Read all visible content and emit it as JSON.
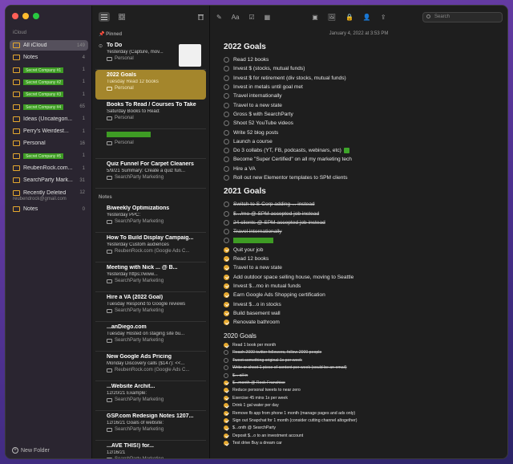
{
  "sidebar": {
    "icloud_label": "iCloud",
    "folders": [
      {
        "name": "All iCloud",
        "count": "149"
      },
      {
        "name": "Notes",
        "count": "4"
      },
      {
        "name": "Secret Company #1",
        "count": "1",
        "redacted": true
      },
      {
        "name": "Secret Company #2",
        "count": "1",
        "redacted": true
      },
      {
        "name": "Secret Company #3",
        "count": "1",
        "redacted": true
      },
      {
        "name": "Secret Company #4",
        "count": "65",
        "redacted": true
      },
      {
        "name": "Ideas (Uncategori...",
        "count": "1"
      },
      {
        "name": "Perry's Weirdest...",
        "count": "1"
      },
      {
        "name": "Personal",
        "count": "16"
      },
      {
        "name": "Secret Company #5",
        "count": "1",
        "redacted": true
      },
      {
        "name": "ReubenRock.com...",
        "count": "1"
      },
      {
        "name": "SearchParty Mark...",
        "count": "31"
      },
      {
        "name": "Recently Deleted",
        "count": "12"
      }
    ],
    "gmail_label": "reubendrock@gmail.com",
    "gmail_folders": [
      {
        "name": "Notes",
        "count": "0"
      }
    ],
    "new_folder": "New Folder"
  },
  "list": {
    "pinned_label": "Pinned",
    "notes_label": "Notes",
    "pinned": [
      {
        "title": "To Do",
        "meta": "Yesterday  (Capture, mov...",
        "folder": "Personal"
      },
      {
        "title": "2022 Goals",
        "meta": "Tuesday  Read 12 books",
        "folder": "Personal"
      },
      {
        "title": "Books To Read / Courses To Take",
        "meta": "Saturday  Books to Read:",
        "folder": "Personal"
      },
      {
        "title": "",
        "meta": "",
        "folder": "Personal"
      },
      {
        "title": "Quiz Funnel For Carpet Cleaners",
        "meta": "5/9/21  Summary: Create a quiz fun...",
        "folder": "SearchParty Marketing"
      }
    ],
    "notes": [
      {
        "title": "Biweekly Optimizations",
        "meta": "Yesterday  PPC:",
        "folder": "SearchParty Marketing"
      },
      {
        "title": "How To Build Display Campaig...",
        "meta": "Yesterday  Custom audiences",
        "folder": "ReubenRock.com (Google Ads C..."
      },
      {
        "title": "Meeting with Nick ... @ B...",
        "meta": "Yesterday  https://www...",
        "folder": "SearchParty Marketing"
      },
      {
        "title": "Hire a VA (2022 Goal)",
        "meta": "Tuesday  Respond to Google reviews",
        "folder": "SearchParty Marketing"
      },
      {
        "title": "...anDiego.com",
        "meta": "Tuesday  Hosted on staging site bu...",
        "folder": "SearchParty Marketing"
      },
      {
        "title": "New Google Ads Pricing",
        "meta": "Monday  Discovery calls ($147): <<...",
        "folder": "ReubenRock.com (Google Ads C..."
      },
      {
        "title": "...Website Archit...",
        "meta": "12/20/21  Example:",
        "folder": "SearchParty Marketing"
      },
      {
        "title": "GSP.com Redesign Notes 1207...",
        "meta": "12/16/21  Goals of website:",
        "folder": "SearchParty Marketing"
      },
      {
        "title": "...AVE THIS!) for...",
        "meta": "12/16/21",
        "folder": "SearchParty Marketing"
      }
    ]
  },
  "editor": {
    "search_placeholder": "Search",
    "date": "January 4, 2022 at 3:53 PM",
    "sections": [
      {
        "heading": "2022 Goals",
        "style": "h2",
        "items": [
          {
            "text": "Read 12 books"
          },
          {
            "text": "Invest $ (stocks, mutual funds)"
          },
          {
            "text": "Invest $ for retirement (div stocks, mutual funds)"
          },
          {
            "text": "Invest in metals until goal met"
          },
          {
            "text": "Travel internationally"
          },
          {
            "text": "Travel to a new state"
          },
          {
            "text": "Gross $ with SearchParty"
          },
          {
            "text": "Shoot 52 YouTube videos"
          },
          {
            "text": "Write 52 blog posts"
          },
          {
            "text": "Launch a course"
          },
          {
            "text": "Do 3 collabs (YT, FB, podcasts, webinars, etc)"
          },
          {
            "text": "Become \"Super Certified\" on all my marketing tech"
          },
          {
            "text": "Hire a VA"
          },
          {
            "text": "Roll out new Elementor templates to SPM clients"
          }
        ]
      },
      {
        "heading": "2021 Goals",
        "style": "h2",
        "items": [
          {
            "text": "Switch to S-Corp adding ... instead",
            "done": false,
            "strike": true
          },
          {
            "text": "$.../mo @ SPM accepted job instead",
            "done": false,
            "strike": true
          },
          {
            "text": "24 clients @ SPM accepted job instead",
            "done": false,
            "strike": true
          },
          {
            "text": "Travel internationally",
            "done": false,
            "strike": true
          },
          {
            "text": "",
            "done": false
          },
          {
            "text": "Quit your job",
            "done": true
          },
          {
            "text": "Read 12 books",
            "done": true
          },
          {
            "text": "Travel to a new state",
            "done": true
          },
          {
            "text": "Add outdoor space selling house, moving to Seattle",
            "done": true
          },
          {
            "text": "Invest $...mo in mutual funds",
            "done": true
          },
          {
            "text": "Earn Google Ads Shopping certification",
            "done": true
          },
          {
            "text": "Invest $...o in stocks",
            "done": true
          },
          {
            "text": "Build basement wall",
            "done": true
          },
          {
            "text": "Renovate bathroom",
            "done": true
          }
        ]
      },
      {
        "heading": "2020 Goals",
        "style": "h3",
        "items": [
          {
            "text": "Read 1 book per month",
            "done": true
          },
          {
            "text": "Reach 2000 twitter followers, follow 2000 people",
            "done": false,
            "strike": true
          },
          {
            "text": "Tweet something original 1x per week",
            "done": false,
            "strike": true
          },
          {
            "text": "Write or shoot 1 piece of content per week (could be an email)",
            "done": false,
            "strike": true
          },
          {
            "text": "$... all in",
            "done": false,
            "strike": true
          },
          {
            "text": "$...month @ Rock Franchise",
            "done": true,
            "strike": true
          },
          {
            "text": "Reduce personal tweets to near zero",
            "done": true
          },
          {
            "text": "Exercise 45 mins 1x per week",
            "done": true
          },
          {
            "text": "Drink 1 gal water per day",
            "done": true
          },
          {
            "text": "Remove fb app from phone 1 month (manage pages and ads only)",
            "done": true
          },
          {
            "text": "Sign out Snapchat for 1 month (consider cutting channel altogether)",
            "done": true
          },
          {
            "text": "$...onth @ SearchParty",
            "done": true
          },
          {
            "text": "Deposit $...o to an investment account",
            "done": true
          },
          {
            "text": "Test drive Buy a dream car",
            "done": true
          }
        ]
      }
    ]
  }
}
